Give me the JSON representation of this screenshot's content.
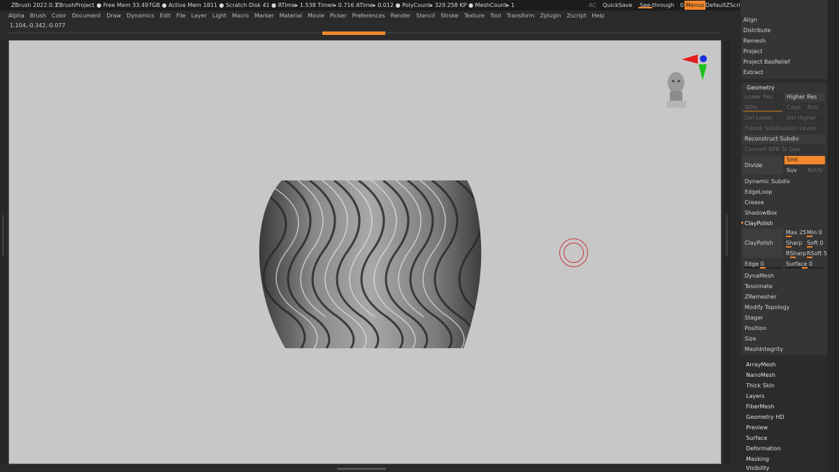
{
  "titlebar": {
    "app": "ZBrush 2022.0.1",
    "project": "ZBrushProject",
    "stats": ". ● Free Mem 33.497GB ● Active Mem 1811 ● Scratch Disk 41 ●  RTime▸ 1.538 Timer▸ 0.716 ATime▸ 0.012 ● PolyCount▸ 329.258 KP  ● MeshCount▸ 1",
    "ac": "AC",
    "quicksave": "QuickSave",
    "seethrough": "See-through",
    "seethrough_value": "0",
    "menus": "Menus",
    "script": "DefaultZScript"
  },
  "menu": [
    "Alpha",
    "Brush",
    "Color",
    "Document",
    "Draw",
    "Dynamics",
    "Edit",
    "File",
    "Layer",
    "Light",
    "Macro",
    "Marker",
    "Material",
    "Movie",
    "Picker",
    "Preferences",
    "Render",
    "Stencil",
    "Stroke",
    "Texture",
    "Tool",
    "Transform",
    "Zplugin",
    "Zscript",
    "Help"
  ],
  "coords": "1.104,-0.342,-0.077",
  "progress": 0.09,
  "panel": {
    "top_items": [
      "Align",
      "Distribute",
      "Remesh",
      "Project",
      "Project BasRelief",
      "Extract"
    ],
    "geometry_title": "Geometry",
    "lower_res": "Lower Res",
    "higher_res": "Higher Res",
    "sdiv": "SDiv",
    "cage": "Cage",
    "rstr": "Rstr",
    "del_lower": "Del Lower",
    "del_higher": "Del Higher",
    "freeze": "Freeze SubDivision Levels",
    "reconstruct": "Reconstruct Subdiv",
    "convert": "Convert BPR To Geo",
    "divide": "Divide",
    "smt": "Smt",
    "suv": "Suv",
    "reuv": "ReUV",
    "dynamic_subdiv": "Dynamic Subdiv",
    "edgeloop": "EdgeLoop",
    "crease": "Crease",
    "shadowbox": "ShadowBox",
    "claypolish_header": "ClayPolish",
    "claypolish": "ClayPolish",
    "max": "Max 25",
    "min": "Min 0",
    "sharp": "Sharp",
    "soft": "Soft 0",
    "rsharp": "RSharp",
    "rsoft": "RSoft 5",
    "edge": "Edge 0",
    "surface": "Surface 0",
    "lower_items": [
      "DynaMesh",
      "Tessimate",
      "ZRemesher",
      "Modify Topology",
      "Stager",
      "Position",
      "Size",
      "MeshIntegrity"
    ],
    "sub_items": [
      "ArrayMesh",
      "NanoMesh",
      "Thick Skin",
      "Layers",
      "FiberMesh",
      "Geometry HD",
      "Preview",
      "Surface",
      "Deformation",
      "Masking",
      "Visibility"
    ]
  },
  "colors": {
    "accent": "#f4882c",
    "viewport": "#c7c7c7",
    "cursor": "#c8373a"
  }
}
